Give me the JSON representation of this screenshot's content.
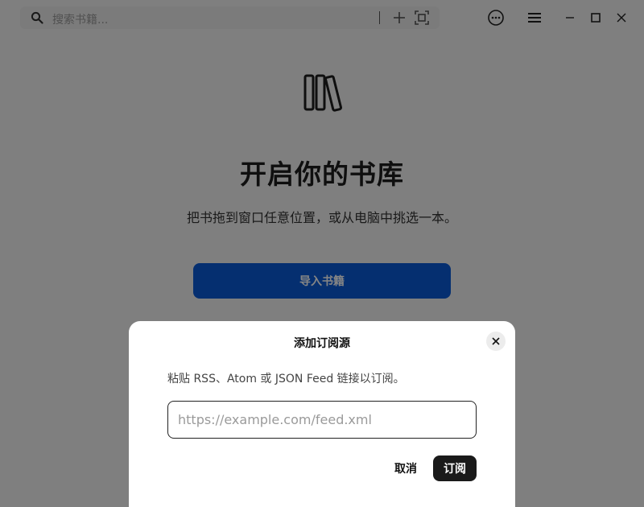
{
  "titlebar": {
    "search_placeholder": "搜索书籍...",
    "icons": [
      "search-icon",
      "add-icon",
      "scan-icon",
      "more-icon",
      "menu-icon",
      "minimize-icon",
      "maximize-icon",
      "close-icon"
    ]
  },
  "empty_state": {
    "icon": "books-icon",
    "title": "开启你的书库",
    "subtitle": "把书拖到窗口任意位置，或从电脑中挑选一本。",
    "import_button": "导入书籍"
  },
  "dialog": {
    "title": "添加订阅源",
    "description": "粘贴 RSS、Atom 或 JSON Feed 链接以订阅。",
    "input_value": "",
    "input_placeholder": "https://example.com/feed.xml",
    "cancel_label": "取消",
    "subscribe_label": "订阅"
  },
  "colors": {
    "accent": "#0a5ad6",
    "dark_button": "#1a1a1a",
    "overlay": "rgba(0,0,0,0.48)"
  }
}
